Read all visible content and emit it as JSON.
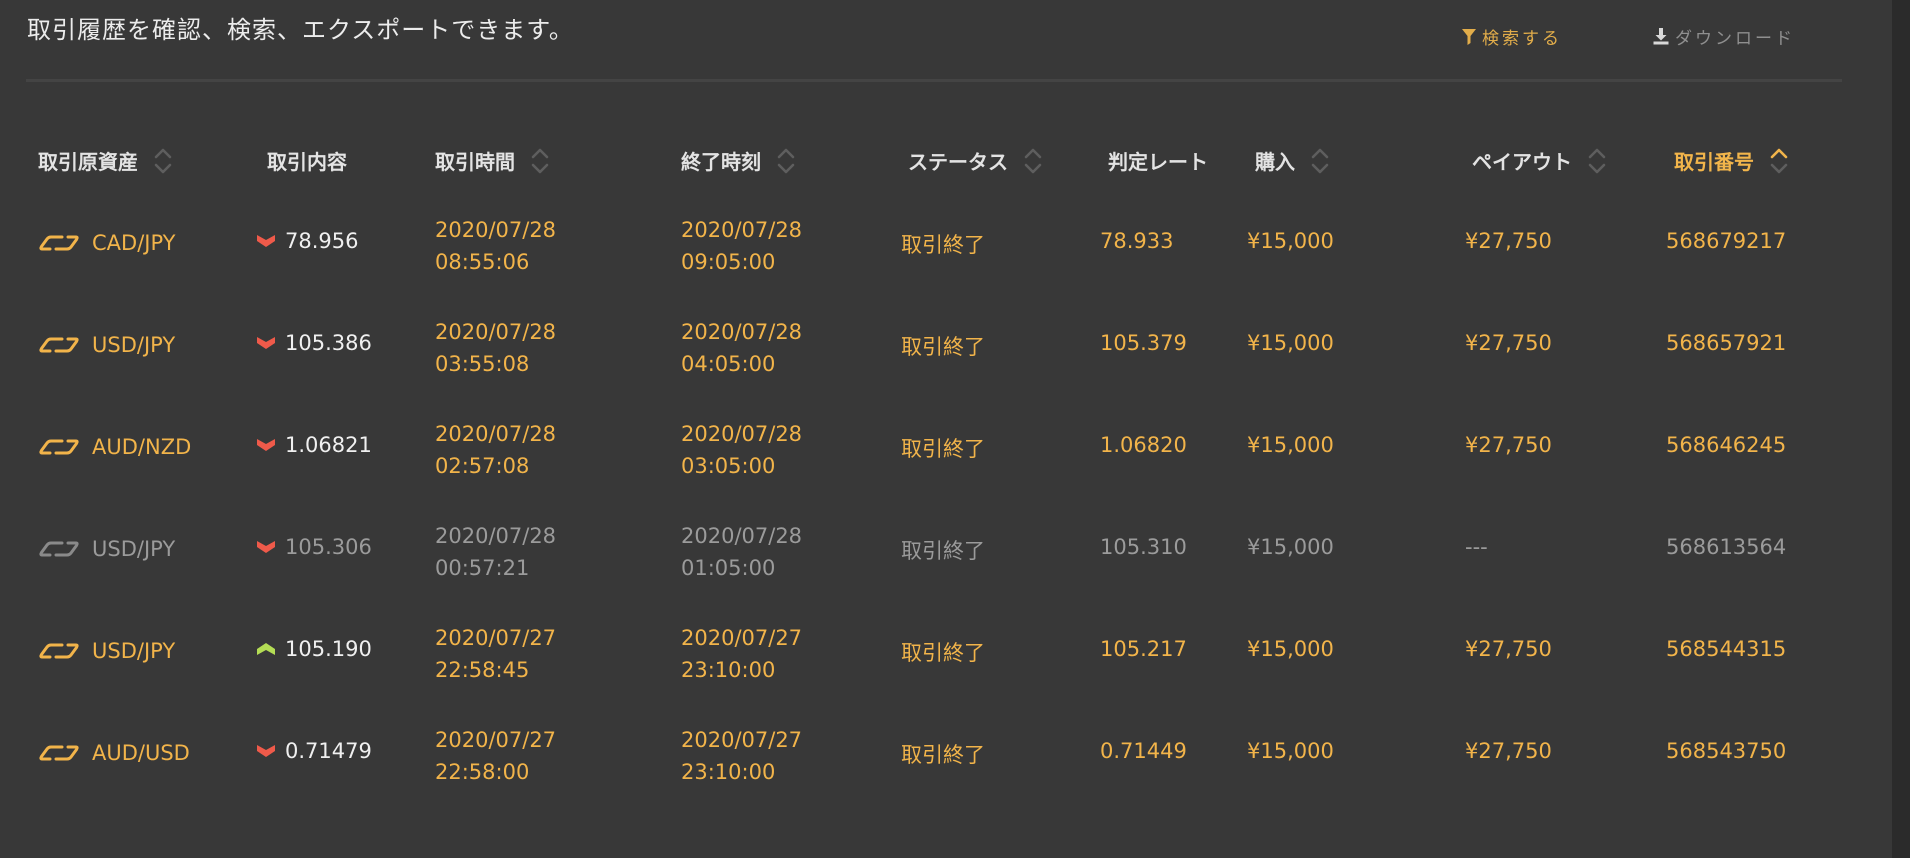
{
  "description": "取引履歴を確認、検索、エクスポートできます。",
  "actions": {
    "search_label": "検索する",
    "download_label": "ダウンロード"
  },
  "columns": [
    {
      "label": "取引原資産",
      "sortable": true
    },
    {
      "label": "取引内容",
      "sortable": false
    },
    {
      "label": "取引時間",
      "sortable": true
    },
    {
      "label": "終了時刻",
      "sortable": true
    },
    {
      "label": "ステータス",
      "sortable": true
    },
    {
      "label": "判定レート",
      "sortable": false
    },
    {
      "label": "購入",
      "sortable": true
    },
    {
      "label": "ペイアウト",
      "sortable": true
    },
    {
      "label": "取引番号",
      "sortable": true,
      "active": true
    }
  ],
  "rows": [
    {
      "asset": "CAD/JPY",
      "direction": "down",
      "rate": "78.956",
      "trade_date": "2020/07/28",
      "trade_time": "08:55:06",
      "end_date": "2020/07/28",
      "end_time": "09:05:00",
      "status": "取引終了",
      "judge_rate": "78.933",
      "purchase": "¥15,000",
      "payout": "¥27,750",
      "trade_no": "568679217",
      "dim": false
    },
    {
      "asset": "USD/JPY",
      "direction": "down",
      "rate": "105.386",
      "trade_date": "2020/07/28",
      "trade_time": "03:55:08",
      "end_date": "2020/07/28",
      "end_time": "04:05:00",
      "status": "取引終了",
      "judge_rate": "105.379",
      "purchase": "¥15,000",
      "payout": "¥27,750",
      "trade_no": "568657921",
      "dim": false
    },
    {
      "asset": "AUD/NZD",
      "direction": "down",
      "rate": "1.06821",
      "trade_date": "2020/07/28",
      "trade_time": "02:57:08",
      "end_date": "2020/07/28",
      "end_time": "03:05:00",
      "status": "取引終了",
      "judge_rate": "1.06820",
      "purchase": "¥15,000",
      "payout": "¥27,750",
      "trade_no": "568646245",
      "dim": false
    },
    {
      "asset": "USD/JPY",
      "direction": "down",
      "rate": "105.306",
      "trade_date": "2020/07/28",
      "trade_time": "00:57:21",
      "end_date": "2020/07/28",
      "end_time": "01:05:00",
      "status": "取引終了",
      "judge_rate": "105.310",
      "purchase": "¥15,000",
      "payout": "---",
      "trade_no": "568613564",
      "dim": true
    },
    {
      "asset": "USD/JPY",
      "direction": "up",
      "rate": "105.190",
      "trade_date": "2020/07/27",
      "trade_time": "22:58:45",
      "end_date": "2020/07/27",
      "end_time": "23:10:00",
      "status": "取引終了",
      "judge_rate": "105.217",
      "purchase": "¥15,000",
      "payout": "¥27,750",
      "trade_no": "568544315",
      "dim": false
    },
    {
      "asset": "AUD/USD",
      "direction": "down",
      "rate": "0.71479",
      "trade_date": "2020/07/27",
      "trade_time": "22:58:00",
      "end_date": "2020/07/27",
      "end_time": "23:10:00",
      "status": "取引終了",
      "judge_rate": "0.71449",
      "purchase": "¥15,000",
      "payout": "¥27,750",
      "trade_no": "568543750",
      "dim": false
    }
  ],
  "colors": {
    "accent": "#f2b44a",
    "down": "#ef5a4a",
    "up": "#b4dd55",
    "dim": "#9b9b9b",
    "background": "#383838"
  }
}
